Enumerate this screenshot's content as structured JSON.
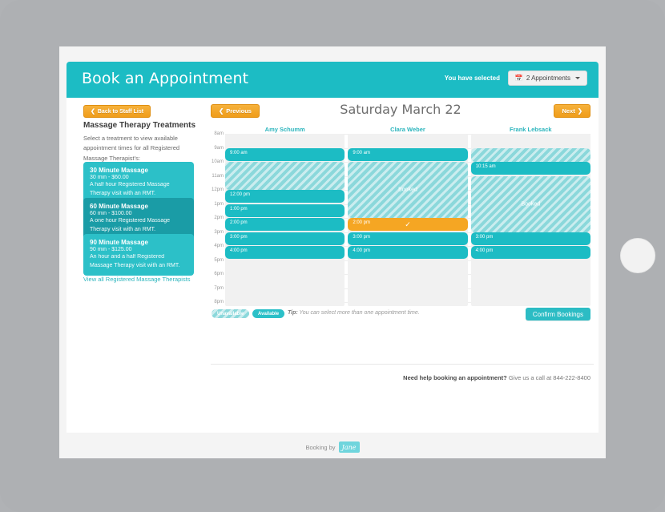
{
  "app": {
    "title": "Book an Appointment",
    "selected_label": "You have selected",
    "appointments_dropdown": "2 Appointments",
    "calendar_icon": "calendar-icon"
  },
  "sidebar": {
    "back_button": "Back to Staff List",
    "title": "Massage Therapy Treatments",
    "description": "Select a treatment to view available appointment times for all Registered Massage Therapist's:",
    "view_all_link": "View all Registered Massage Therapists",
    "treatments": [
      {
        "name": "30 Minute Massage",
        "price": "30 min - $60.00",
        "description": "A half hour Registered Massage Therapy visit with an RMT.",
        "selected": false
      },
      {
        "name": "60 Minute Massage",
        "price": "60 min - $100.00",
        "description": "A one hour Registered Massage Therapy visit with an RMT.",
        "selected": true
      },
      {
        "name": "90 Minute Massage",
        "price": "90 min - $125.00",
        "description": "An hour and a half Registered Massage Therapy visit with an RMT.",
        "selected": false
      }
    ]
  },
  "calendar": {
    "prev_button": "Previous",
    "next_button": "Next",
    "date_title": "Saturday March 22",
    "hours": [
      "8am",
      "9am",
      "10am",
      "11am",
      "12pm",
      "1pm",
      "2pm",
      "3pm",
      "4pm",
      "5pm",
      "6pm",
      "7pm",
      "8pm"
    ],
    "columns": [
      {
        "staff": "Amy Schumm",
        "slots": [
          {
            "type": "available",
            "time": "9:00 am",
            "start": "9am",
            "end": "10am"
          },
          {
            "type": "blocked",
            "label": "",
            "start": "10am",
            "end": "12pm"
          },
          {
            "type": "available",
            "time": "12:00 pm",
            "start": "12pm",
            "end": "1pm"
          },
          {
            "type": "available",
            "time": "1:00 pm",
            "start": "1pm",
            "end": "2pm"
          },
          {
            "type": "available",
            "time": "2:00 pm",
            "start": "2pm",
            "end": "3pm"
          },
          {
            "type": "available",
            "time": "3:00 pm",
            "start": "3pm",
            "end": "4pm"
          },
          {
            "type": "available",
            "time": "4:00 pm",
            "start": "4pm",
            "end": "5pm"
          }
        ]
      },
      {
        "staff": "Clara Weber",
        "slots": [
          {
            "type": "available",
            "time": "9:00 am",
            "start": "9am",
            "end": "10am"
          },
          {
            "type": "blocked",
            "label": "Booked",
            "start": "10am",
            "end": "2pm"
          },
          {
            "type": "selected",
            "time": "2:00 pm",
            "check": "✓",
            "start": "2pm",
            "end": "3pm"
          },
          {
            "type": "available",
            "time": "3:00 pm",
            "start": "3pm",
            "end": "4pm"
          },
          {
            "type": "available",
            "time": "4:00 pm",
            "start": "4pm",
            "end": "5pm"
          }
        ]
      },
      {
        "staff": "Frank Lebsack",
        "slots": [
          {
            "type": "blocked",
            "label": "",
            "start": "9am",
            "end": "10am"
          },
          {
            "type": "available",
            "time": "10:15 am",
            "start": "10am",
            "end": "11am"
          },
          {
            "type": "blocked",
            "label": "Booked",
            "start": "11am",
            "end": "3pm"
          },
          {
            "type": "available",
            "time": "3:00 pm",
            "start": "3pm",
            "end": "4pm"
          },
          {
            "type": "available",
            "time": "4:00 pm",
            "start": "4pm",
            "end": "5pm"
          }
        ]
      }
    ]
  },
  "legend": {
    "unavailable": "Unavailable",
    "available": "Available",
    "tip_prefix": "Tip:",
    "tip_text": " You can select more than one appointment time.",
    "confirm_button": "Confirm Bookings"
  },
  "help": {
    "question": "Need help booking an appointment?",
    "answer": " Give us a call at 844-222-8400"
  },
  "branding": {
    "text": "Booking by",
    "logo": "Jane"
  },
  "colors": {
    "teal": "#1cbcc4",
    "teal_light": "#2cc0c8",
    "teal_dark": "#1a9ca6",
    "orange": "#f5a623",
    "blocked": "#8bd8db"
  }
}
